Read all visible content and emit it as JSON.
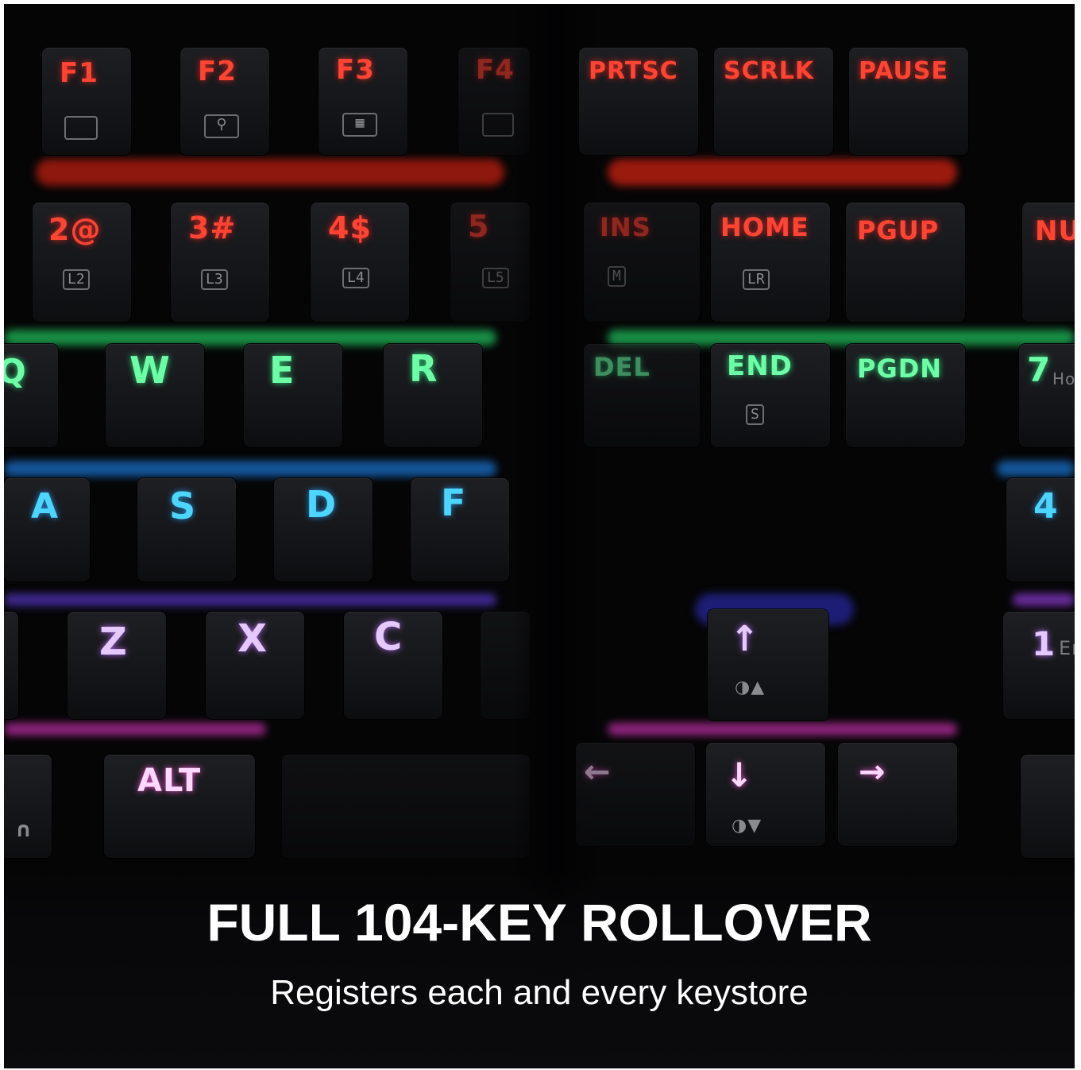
{
  "image": {
    "headline": "FULL 104-KEY ROLLOVER",
    "subheadline": "Registers each and every keystore"
  },
  "left_panel": {
    "row_function": [
      {
        "label": "F1",
        "sub_icon": "laptop-icon"
      },
      {
        "label": "F2",
        "sub_icon": "search-icon"
      },
      {
        "label": "F3",
        "sub_icon": "calculator-icon"
      },
      {
        "label": "F4",
        "sub_icon": "email-icon"
      }
    ],
    "row_numbers": [
      {
        "label": "2@",
        "sub": "L2"
      },
      {
        "label": "3#",
        "sub": "L3"
      },
      {
        "label": "4$",
        "sub": "L4"
      },
      {
        "label": "5",
        "sub": "L5"
      }
    ],
    "row_qwer": [
      "Q",
      "W",
      "E",
      "R"
    ],
    "row_asdf": [
      "A",
      "S",
      "D",
      "F"
    ],
    "row_zxc": [
      "Z",
      "X",
      "C"
    ],
    "row_bottom": [
      {
        "label": "ALT"
      }
    ]
  },
  "right_panel": {
    "row_system": [
      "PRTSC",
      "SCRLK",
      "PAUSE"
    ],
    "row_nav_top": [
      {
        "label": "INS",
        "sub": "M"
      },
      {
        "label": "HOME",
        "sub": "LR"
      },
      {
        "label": "PGUP"
      },
      {
        "label": "NU"
      }
    ],
    "row_nav_bottom": [
      {
        "label": "DEL"
      },
      {
        "label": "END",
        "sub": "S"
      },
      {
        "label": "PGDN"
      },
      {
        "label": "7",
        "sub_text": "Ho"
      }
    ],
    "numpad": [
      {
        "label": "4"
      },
      {
        "label": "1",
        "sub_text": "En"
      }
    ],
    "arrows": {
      "up": "↑",
      "down": "↓",
      "left": "←",
      "right": "→",
      "brightness_up": "◑▲",
      "brightness_down": "◑▼"
    }
  },
  "colors": {
    "row_red": "#ff4434",
    "row_green": "#6dffa8",
    "row_blue": "#4cd6ff",
    "row_violet": "#e4c8ff",
    "row_pink": "#ffd8ff",
    "background": "#050506",
    "caption": "#ffffff"
  }
}
